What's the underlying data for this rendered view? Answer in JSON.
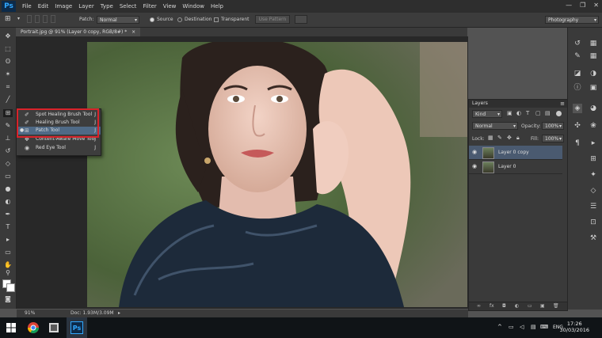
{
  "menubar": {
    "logo": "Ps",
    "items": [
      "File",
      "Edit",
      "Image",
      "Layer",
      "Type",
      "Select",
      "Filter",
      "View",
      "Window",
      "Help"
    ]
  },
  "options": {
    "patch_label": "Patch:",
    "patch_mode": "Normal",
    "source_label": "Source",
    "destination_label": "Destination",
    "transparent_label": "Transparent",
    "use_pattern": "Use Pattern",
    "workspace": "Photography"
  },
  "document": {
    "tab_title": "Portrait.jpg @ 91% (Layer 0 copy, RGB/8#) *",
    "zoom": "91%",
    "doc_info": "Doc: 1.93M/3.09M"
  },
  "flyout": {
    "items": [
      {
        "label": "Spot Healing Brush Tool",
        "key": "J"
      },
      {
        "label": "Healing Brush Tool",
        "key": "J"
      },
      {
        "label": "Patch Tool",
        "key": "J"
      },
      {
        "label": "Content-Aware Move Tool",
        "key": "J"
      },
      {
        "label": "Red Eye Tool",
        "key": "J"
      }
    ]
  },
  "layers_panel": {
    "title": "Layers",
    "filter": "Kind",
    "blend_mode": "Normal",
    "opacity_label": "Opacity:",
    "opacity_value": "100%",
    "lock_label": "Lock:",
    "fill_label": "Fill:",
    "fill_value": "100%",
    "layers": [
      {
        "name": "Layer 0 copy"
      },
      {
        "name": "Layer 0"
      }
    ]
  },
  "taskbar": {
    "lang": "ENG",
    "time": "17:26",
    "date": "30/03/2016"
  }
}
